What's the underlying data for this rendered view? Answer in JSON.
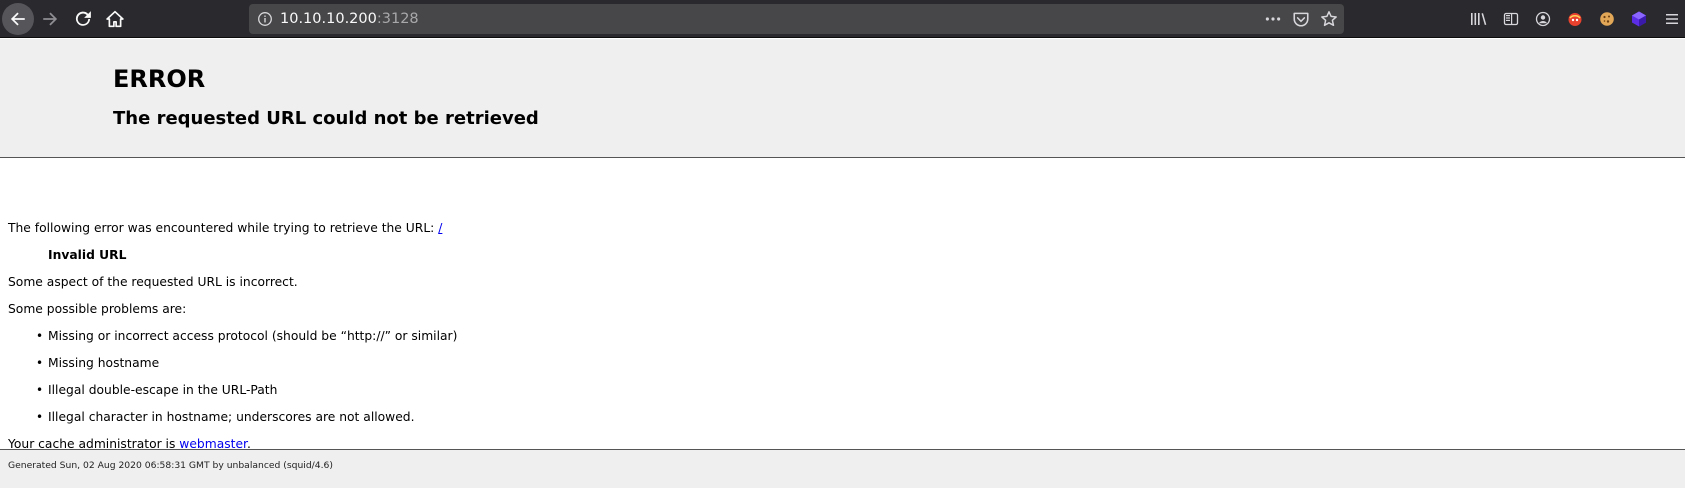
{
  "browser": {
    "url_host": "10.10.10.200",
    "url_port": ":3128",
    "icons": {
      "back": "back-arrow-icon",
      "forward": "forward-arrow-icon",
      "reload": "reload-icon",
      "home": "home-icon",
      "info": "info-icon",
      "more": "more-actions-icon",
      "pocket": "pocket-icon",
      "bookmark": "star-icon",
      "library": "library-icon",
      "sidebar": "sidebar-icon",
      "account": "account-icon",
      "ext1": "extension-icon",
      "ext2": "cookie-icon",
      "ext3": "extension-cube-icon",
      "menu": "hamburger-menu-icon"
    },
    "colors": {
      "toolbar": "#2a2a2e",
      "urlbar": "#474749",
      "icon": "#f9f9fa"
    }
  },
  "page": {
    "title": "ERROR",
    "subtitle": "The requested URL could not be retrieved",
    "intro_text": "The following error was encountered while trying to retrieve the URL: ",
    "intro_link": "/",
    "error_name": "Invalid URL",
    "description": "Some aspect of the requested URL is incorrect.",
    "problems_heading": "Some possible problems are:",
    "problems": [
      "Missing or incorrect access protocol (should be “http://” or similar)",
      "Missing hostname",
      "Illegal double-escape in the URL-Path",
      "Illegal character in hostname; underscores are not allowed."
    ],
    "admin_prefix": "Your cache administrator is ",
    "admin_link": "webmaster",
    "admin_suffix": ".",
    "footer": "Generated Sun, 02 Aug 2020 06:58:31 GMT by unbalanced (squid/4.6)"
  }
}
